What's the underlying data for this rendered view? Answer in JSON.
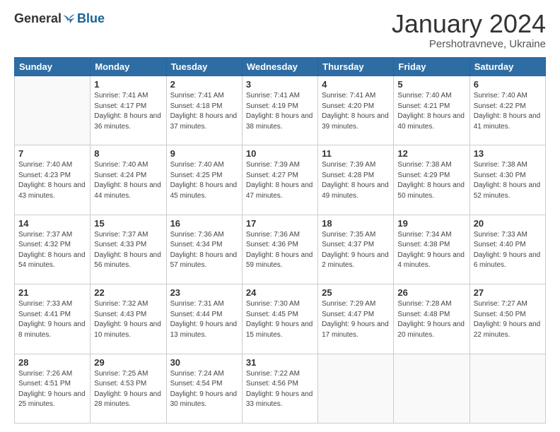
{
  "logo": {
    "general": "General",
    "blue": "Blue"
  },
  "header": {
    "month": "January 2024",
    "location": "Pershotravneve, Ukraine"
  },
  "days_of_week": [
    "Sunday",
    "Monday",
    "Tuesday",
    "Wednesday",
    "Thursday",
    "Friday",
    "Saturday"
  ],
  "weeks": [
    [
      {
        "day": "",
        "sunrise": "",
        "sunset": "",
        "daylight": ""
      },
      {
        "day": "1",
        "sunrise": "Sunrise: 7:41 AM",
        "sunset": "Sunset: 4:17 PM",
        "daylight": "Daylight: 8 hours and 36 minutes."
      },
      {
        "day": "2",
        "sunrise": "Sunrise: 7:41 AM",
        "sunset": "Sunset: 4:18 PM",
        "daylight": "Daylight: 8 hours and 37 minutes."
      },
      {
        "day": "3",
        "sunrise": "Sunrise: 7:41 AM",
        "sunset": "Sunset: 4:19 PM",
        "daylight": "Daylight: 8 hours and 38 minutes."
      },
      {
        "day": "4",
        "sunrise": "Sunrise: 7:41 AM",
        "sunset": "Sunset: 4:20 PM",
        "daylight": "Daylight: 8 hours and 39 minutes."
      },
      {
        "day": "5",
        "sunrise": "Sunrise: 7:40 AM",
        "sunset": "Sunset: 4:21 PM",
        "daylight": "Daylight: 8 hours and 40 minutes."
      },
      {
        "day": "6",
        "sunrise": "Sunrise: 7:40 AM",
        "sunset": "Sunset: 4:22 PM",
        "daylight": "Daylight: 8 hours and 41 minutes."
      }
    ],
    [
      {
        "day": "7",
        "sunrise": "Sunrise: 7:40 AM",
        "sunset": "Sunset: 4:23 PM",
        "daylight": "Daylight: 8 hours and 43 minutes."
      },
      {
        "day": "8",
        "sunrise": "Sunrise: 7:40 AM",
        "sunset": "Sunset: 4:24 PM",
        "daylight": "Daylight: 8 hours and 44 minutes."
      },
      {
        "day": "9",
        "sunrise": "Sunrise: 7:40 AM",
        "sunset": "Sunset: 4:25 PM",
        "daylight": "Daylight: 8 hours and 45 minutes."
      },
      {
        "day": "10",
        "sunrise": "Sunrise: 7:39 AM",
        "sunset": "Sunset: 4:27 PM",
        "daylight": "Daylight: 8 hours and 47 minutes."
      },
      {
        "day": "11",
        "sunrise": "Sunrise: 7:39 AM",
        "sunset": "Sunset: 4:28 PM",
        "daylight": "Daylight: 8 hours and 49 minutes."
      },
      {
        "day": "12",
        "sunrise": "Sunrise: 7:38 AM",
        "sunset": "Sunset: 4:29 PM",
        "daylight": "Daylight: 8 hours and 50 minutes."
      },
      {
        "day": "13",
        "sunrise": "Sunrise: 7:38 AM",
        "sunset": "Sunset: 4:30 PM",
        "daylight": "Daylight: 8 hours and 52 minutes."
      }
    ],
    [
      {
        "day": "14",
        "sunrise": "Sunrise: 7:37 AM",
        "sunset": "Sunset: 4:32 PM",
        "daylight": "Daylight: 8 hours and 54 minutes."
      },
      {
        "day": "15",
        "sunrise": "Sunrise: 7:37 AM",
        "sunset": "Sunset: 4:33 PM",
        "daylight": "Daylight: 8 hours and 56 minutes."
      },
      {
        "day": "16",
        "sunrise": "Sunrise: 7:36 AM",
        "sunset": "Sunset: 4:34 PM",
        "daylight": "Daylight: 8 hours and 57 minutes."
      },
      {
        "day": "17",
        "sunrise": "Sunrise: 7:36 AM",
        "sunset": "Sunset: 4:36 PM",
        "daylight": "Daylight: 8 hours and 59 minutes."
      },
      {
        "day": "18",
        "sunrise": "Sunrise: 7:35 AM",
        "sunset": "Sunset: 4:37 PM",
        "daylight": "Daylight: 9 hours and 2 minutes."
      },
      {
        "day": "19",
        "sunrise": "Sunrise: 7:34 AM",
        "sunset": "Sunset: 4:38 PM",
        "daylight": "Daylight: 9 hours and 4 minutes."
      },
      {
        "day": "20",
        "sunrise": "Sunrise: 7:33 AM",
        "sunset": "Sunset: 4:40 PM",
        "daylight": "Daylight: 9 hours and 6 minutes."
      }
    ],
    [
      {
        "day": "21",
        "sunrise": "Sunrise: 7:33 AM",
        "sunset": "Sunset: 4:41 PM",
        "daylight": "Daylight: 9 hours and 8 minutes."
      },
      {
        "day": "22",
        "sunrise": "Sunrise: 7:32 AM",
        "sunset": "Sunset: 4:43 PM",
        "daylight": "Daylight: 9 hours and 10 minutes."
      },
      {
        "day": "23",
        "sunrise": "Sunrise: 7:31 AM",
        "sunset": "Sunset: 4:44 PM",
        "daylight": "Daylight: 9 hours and 13 minutes."
      },
      {
        "day": "24",
        "sunrise": "Sunrise: 7:30 AM",
        "sunset": "Sunset: 4:45 PM",
        "daylight": "Daylight: 9 hours and 15 minutes."
      },
      {
        "day": "25",
        "sunrise": "Sunrise: 7:29 AM",
        "sunset": "Sunset: 4:47 PM",
        "daylight": "Daylight: 9 hours and 17 minutes."
      },
      {
        "day": "26",
        "sunrise": "Sunrise: 7:28 AM",
        "sunset": "Sunset: 4:48 PM",
        "daylight": "Daylight: 9 hours and 20 minutes."
      },
      {
        "day": "27",
        "sunrise": "Sunrise: 7:27 AM",
        "sunset": "Sunset: 4:50 PM",
        "daylight": "Daylight: 9 hours and 22 minutes."
      }
    ],
    [
      {
        "day": "28",
        "sunrise": "Sunrise: 7:26 AM",
        "sunset": "Sunset: 4:51 PM",
        "daylight": "Daylight: 9 hours and 25 minutes."
      },
      {
        "day": "29",
        "sunrise": "Sunrise: 7:25 AM",
        "sunset": "Sunset: 4:53 PM",
        "daylight": "Daylight: 9 hours and 28 minutes."
      },
      {
        "day": "30",
        "sunrise": "Sunrise: 7:24 AM",
        "sunset": "Sunset: 4:54 PM",
        "daylight": "Daylight: 9 hours and 30 minutes."
      },
      {
        "day": "31",
        "sunrise": "Sunrise: 7:22 AM",
        "sunset": "Sunset: 4:56 PM",
        "daylight": "Daylight: 9 hours and 33 minutes."
      },
      {
        "day": "",
        "sunrise": "",
        "sunset": "",
        "daylight": ""
      },
      {
        "day": "",
        "sunrise": "",
        "sunset": "",
        "daylight": ""
      },
      {
        "day": "",
        "sunrise": "",
        "sunset": "",
        "daylight": ""
      }
    ]
  ]
}
